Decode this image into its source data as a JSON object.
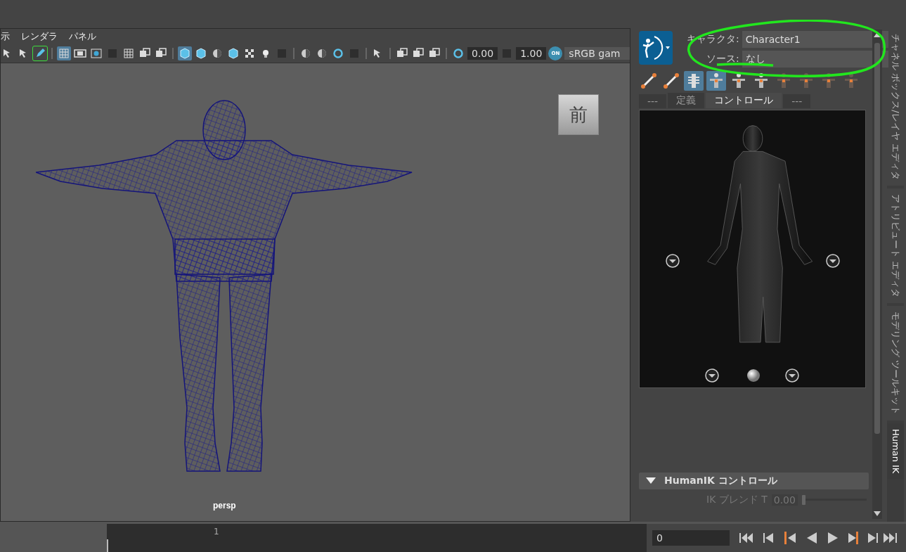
{
  "viewport_panel": {
    "menu": [
      "示",
      "レンダラ",
      "パネル"
    ],
    "toolbar": [
      {
        "kind": "arrow",
        "selected": false
      },
      {
        "kind": "arrow",
        "selected": false
      },
      {
        "kind": "pencil",
        "selected": true
      },
      {
        "kind": "sep"
      },
      {
        "kind": "grid",
        "selected": true
      },
      {
        "kind": "film",
        "selected": false
      },
      {
        "kind": "dot",
        "selected": false
      },
      {
        "kind": "dark",
        "selected": false
      },
      {
        "kind": "grid",
        "selected": false
      },
      {
        "kind": "square",
        "selected": false
      },
      {
        "kind": "square",
        "selected": false
      },
      {
        "kind": "sep"
      },
      {
        "kind": "cube",
        "selected": true
      },
      {
        "kind": "cube",
        "selected": false
      },
      {
        "kind": "sphere",
        "selected": false
      },
      {
        "kind": "cube",
        "selected": false
      },
      {
        "kind": "checker",
        "selected": false
      },
      {
        "kind": "bulb",
        "selected": false
      },
      {
        "kind": "dark",
        "selected": false
      },
      {
        "kind": "sep"
      },
      {
        "kind": "sphere",
        "selected": false
      },
      {
        "kind": "sphere",
        "selected": false
      },
      {
        "kind": "ring",
        "selected": false
      },
      {
        "kind": "dark",
        "selected": false
      },
      {
        "kind": "sep"
      },
      {
        "kind": "arrow",
        "selected": false
      },
      {
        "kind": "sep"
      },
      {
        "kind": "square",
        "selected": false
      },
      {
        "kind": "square",
        "selected": false
      },
      {
        "kind": "square",
        "selected": false
      },
      {
        "kind": "sep"
      },
      {
        "kind": "ring",
        "selected": false
      },
      {
        "kind": "value",
        "value": "0.00"
      },
      {
        "kind": "dark",
        "selected": false
      },
      {
        "kind": "value",
        "value": "1.00"
      },
      {
        "kind": "badge",
        "value": "ON"
      },
      {
        "kind": "value",
        "value": "sRGB gam"
      }
    ],
    "view_cube": "前",
    "camera_label": "persp"
  },
  "humanik": {
    "character_label": "キャラクタ:",
    "character": "Character1",
    "source_label": "ソース:",
    "source": "なし",
    "tools": [
      {
        "selected": false
      },
      {
        "selected": false
      },
      {
        "selected": true
      },
      {
        "selected": true
      },
      {
        "selected": false
      },
      {
        "selected": false
      },
      {
        "selected": false
      },
      {
        "selected": false
      },
      {
        "selected": false
      },
      {
        "selected": false
      }
    ],
    "tabs": [
      {
        "label": "---",
        "selected": false
      },
      {
        "label": "定義",
        "selected": false
      },
      {
        "label": "コントロール",
        "selected": true
      },
      {
        "label": "---",
        "selected": false
      }
    ],
    "section": {
      "title": "HumanIK コントロール",
      "expanded": true
    },
    "blend": {
      "label": "IK ブレンド T",
      "value": "0.00",
      "level": 0,
      "disabled": true
    }
  },
  "side_tabs": [
    {
      "label": "チャネル ボックス/レイヤ エディタ",
      "selected": false
    },
    {
      "label": "アトリビュート エディタ",
      "selected": false
    },
    {
      "label": "モデリング ツールキット",
      "selected": false
    },
    {
      "label": "Human IK",
      "selected": true
    }
  ],
  "timeline": {
    "tick": "1",
    "frame": "0",
    "level": 0
  }
}
